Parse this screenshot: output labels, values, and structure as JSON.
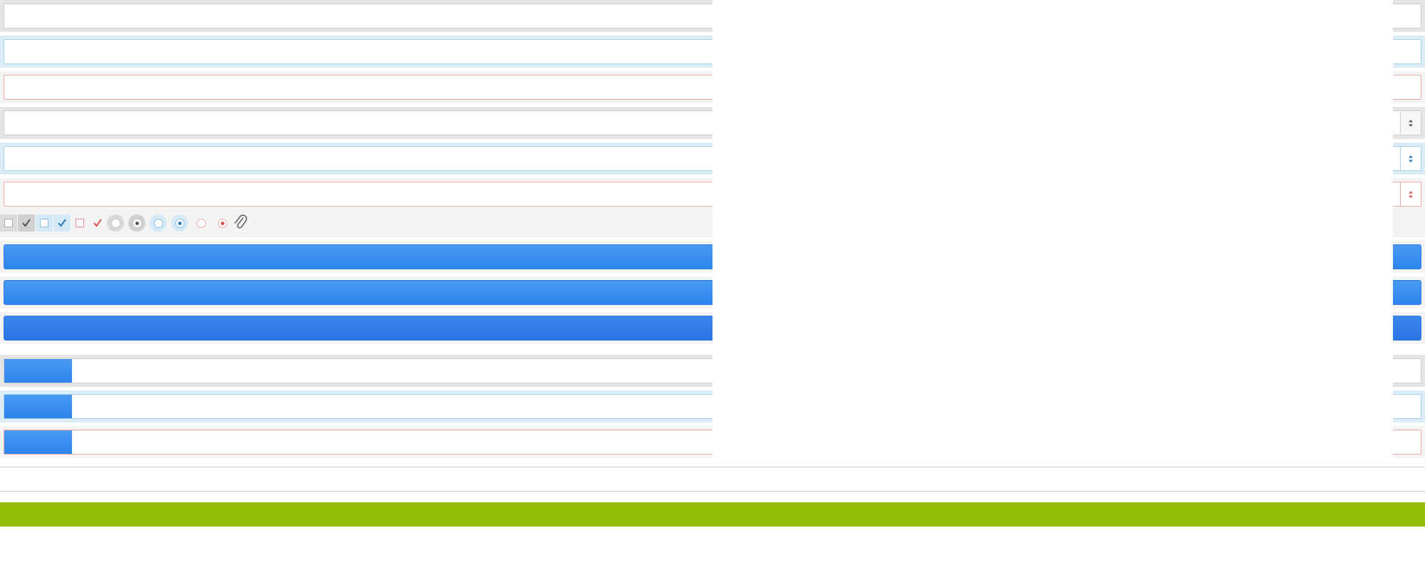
{
  "form": {
    "text_inputs": [
      {
        "state": "default",
        "value": ""
      },
      {
        "state": "info",
        "value": ""
      },
      {
        "state": "error",
        "value": ""
      }
    ],
    "selects": [
      {
        "state": "default",
        "selected": ""
      },
      {
        "state": "info",
        "selected": ""
      },
      {
        "state": "error",
        "selected": ""
      }
    ],
    "checkboxes": [
      {
        "state": "default",
        "checked": false
      },
      {
        "state": "default",
        "checked": true
      },
      {
        "state": "info",
        "checked": false
      },
      {
        "state": "info",
        "checked": true
      },
      {
        "state": "error",
        "checked": false
      },
      {
        "state": "error",
        "checked": true
      }
    ],
    "radios": [
      {
        "state": "default",
        "checked": false
      },
      {
        "state": "default",
        "checked": true
      },
      {
        "state": "info",
        "checked": false
      },
      {
        "state": "info",
        "checked": true
      },
      {
        "state": "error",
        "checked": false
      },
      {
        "state": "error",
        "checked": true
      }
    ],
    "attachment_icon": "paperclip-icon",
    "buttons": [
      {
        "state": "default",
        "label": ""
      },
      {
        "state": "hover",
        "label": ""
      },
      {
        "state": "pressed",
        "label": ""
      }
    ],
    "file_inputs": [
      {
        "state": "default",
        "button_label": "",
        "filename": ""
      },
      {
        "state": "info",
        "button_label": "",
        "filename": ""
      },
      {
        "state": "error",
        "button_label": "",
        "filename": ""
      }
    ]
  },
  "colors": {
    "accent_blue": "#3b8bee",
    "info_border": "#a8d1ec",
    "error_border": "#f3a8a8",
    "error_check": "#d9534f",
    "info_check": "#2a7ab8",
    "green_bar": "#93bd04"
  }
}
